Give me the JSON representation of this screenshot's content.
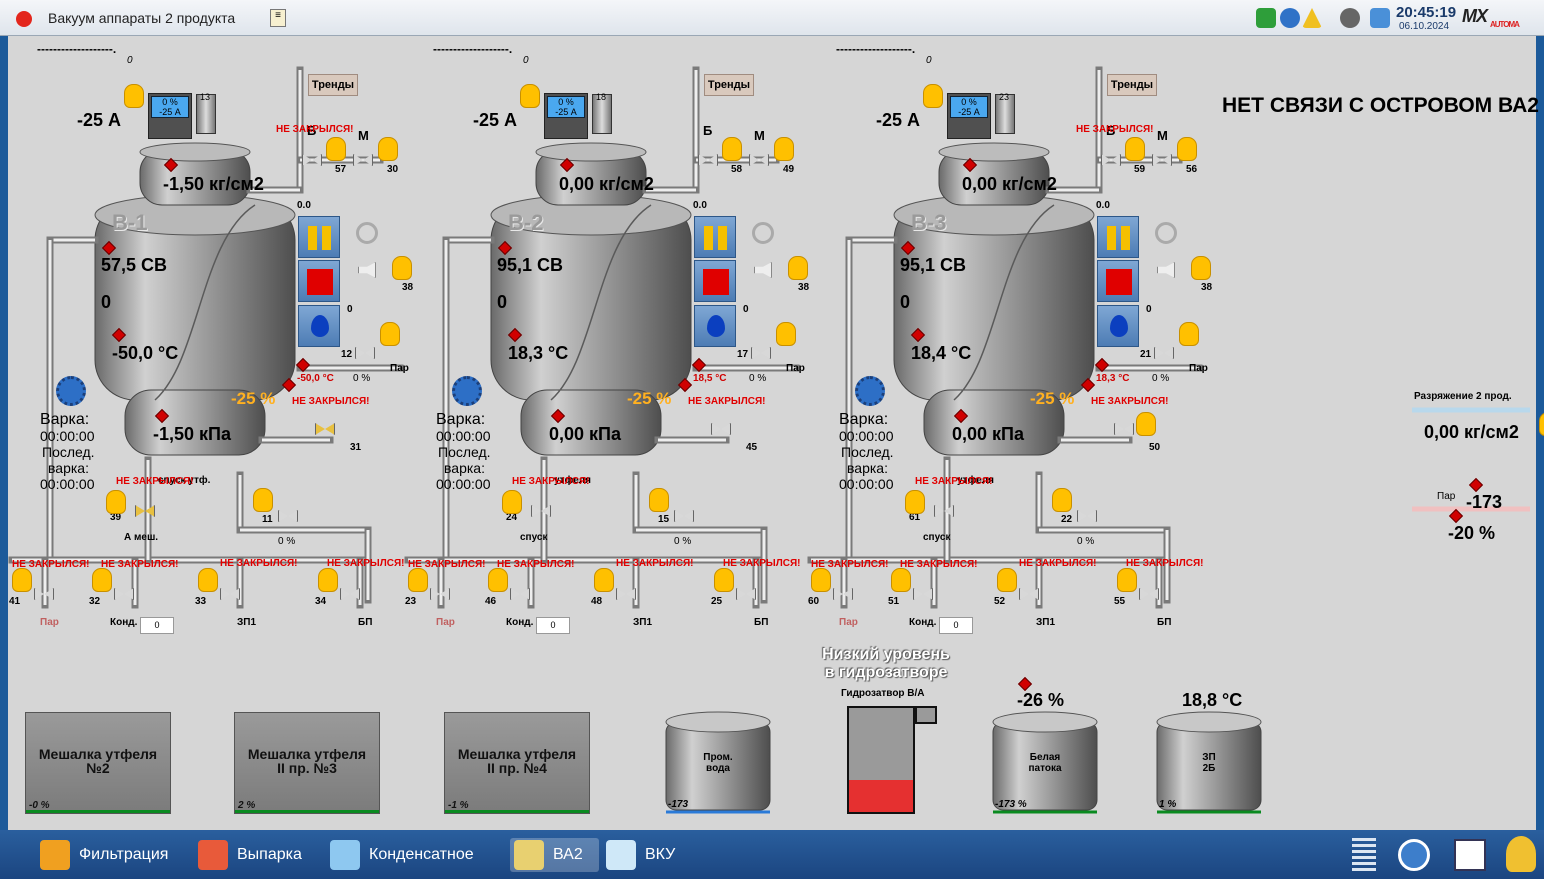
{
  "window": {
    "title": "Вакуум аппараты 2 продукта",
    "time": "20:45:19",
    "date": "06.10.2024",
    "logo": "AUTOMA"
  },
  "banner": "НЕТ СВЯЗИ С ОСТРОВОМ ВА2",
  "trend_label": "Тренды",
  "warn_text": "НЕ ЗАКРЫЛСЯ!",
  "apparatus": [
    {
      "name": "В-1",
      "dashes": "-------------------.",
      "counter": "0",
      "current": "-25 А",
      "meter_pct": "0 %",
      "meter_a": "-25 А",
      "meter_num": "13",
      "pressure_top": "-1,50 кг/см2",
      "sv": "57,5 СВ",
      "zero": "0",
      "temp": "-50,0 °C",
      "level_pct": "-25 %",
      "bottom": "-1,50 кПа",
      "steam_temp": "-50,0 °C",
      "steam_pct": "0 %",
      "steam_valve": "12",
      "steam_label": "Пар",
      "pv": "0.0",
      "varka": "Варка:",
      "varka_time": "00:00:00",
      "posled": "Послед.",
      "varka2": "варка:",
      "posled_time": "00:00:00",
      "valve_b": "Б",
      "valve_m": "М",
      "v_top1": "57",
      "v_top2": "30",
      "v_side": "38",
      "v_side2": "0",
      "v_mid": "31",
      "v_drain": "39",
      "drain_label": "А меш.",
      "drain_label2": "спуск утф.",
      "v_cond": "11",
      "cond_pct": "0 %",
      "bottom_valves": [
        "41",
        "32",
        "33",
        "34"
      ],
      "bottom_labels": [
        "Пар",
        "Конд.",
        "ЗП1",
        "БП"
      ],
      "cond_input": "0",
      "steam_small": "Пар"
    },
    {
      "name": "В-2",
      "dashes": "-------------------.",
      "counter": "0",
      "current": "-25 А",
      "meter_pct": "0 %",
      "meter_a": "-25 А",
      "meter_num": "18",
      "pressure_top": "0,00 кг/см2",
      "sv": "95,1 СВ",
      "zero": "0",
      "temp": "18,3 °C",
      "level_pct": "-25 %",
      "bottom": "0,00 кПа",
      "steam_temp": "18,5 °C",
      "steam_pct": "0 %",
      "steam_valve": "17",
      "steam_label": "Пар",
      "pv": "0.0",
      "varka": "Варка:",
      "varka_time": "00:00:00",
      "posled": "Послед.",
      "varka2": "варка:",
      "posled_time": "00:00:00",
      "valve_b": "Б",
      "valve_m": "М",
      "v_top1": "58",
      "v_top2": "49",
      "v_side": "38",
      "v_side2": "0",
      "v_mid": "45",
      "v_drain": "24",
      "drain_label": "спуск",
      "drain_label2": "утфеля",
      "v_cond": "15",
      "cond_pct": "0 %",
      "bottom_valves": [
        "23",
        "46",
        "48",
        "25"
      ],
      "bottom_labels": [
        "Пар",
        "Конд.",
        "ЗП1",
        "БП"
      ],
      "cond_input": "0",
      "steam_small": ""
    },
    {
      "name": "В-3",
      "dashes": "-------------------.",
      "counter": "0",
      "current": "-25 А",
      "meter_pct": "0 %",
      "meter_a": "-25 А",
      "meter_num": "23",
      "pressure_top": "0,00 кг/см2",
      "sv": "95,1 СВ",
      "zero": "0",
      "temp": "18,4 °C",
      "level_pct": "-25 %",
      "bottom": "0,00 кПа",
      "steam_temp": "18,3 °C",
      "steam_pct": "0 %",
      "steam_valve": "21",
      "steam_label": "Пар",
      "pv": "0.0",
      "varka": "Варка:",
      "varka_time": "00:00:00",
      "posled": "Послед.",
      "varka2": "варка:",
      "posled_time": "00:00:00",
      "valve_b": "Б",
      "valve_m": "М",
      "v_top1": "59",
      "v_top2": "56",
      "v_side": "38",
      "v_side2": "0",
      "v_mid": "50",
      "v_drain": "61",
      "drain_label": "спуск",
      "drain_label2": "утфеля",
      "v_cond": "22",
      "cond_pct": "0 %",
      "bottom_valves": [
        "60",
        "51",
        "52",
        "55"
      ],
      "bottom_labels": [
        "Пар",
        "Конд.",
        "ЗП1",
        "БП"
      ],
      "cond_input": "0",
      "steam_small": ""
    }
  ],
  "vacuum": {
    "label": "Разряжение 2 прод.",
    "value": "0,00 кг/см2"
  },
  "steam_right": {
    "label": "Пар",
    "value": "-173",
    "pct": "-20 %"
  },
  "mixers": [
    {
      "name": "Мешалка утфеля",
      "name2": "№2",
      "pct": "-0 %"
    },
    {
      "name": "Мешалка утфеля",
      "name2": "II пр. №3",
      "pct": "2 %"
    },
    {
      "name": "Мешалка утфеля",
      "name2": "II пр. №4",
      "pct": "-1 %"
    }
  ],
  "tanks": [
    {
      "name": "Пром.",
      "name2": "вода",
      "bottom": "-173",
      "top": ""
    },
    {
      "name": "Белая",
      "name2": "патока",
      "bottom": "-173 %",
      "top": "-26 %"
    },
    {
      "name": "ЗП",
      "name2": "2Б",
      "bottom": "1 %",
      "top": "18,8 °C"
    }
  ],
  "hydro": {
    "alarm1": "Низкий уровень",
    "alarm2": "в гидрозатворе",
    "label": "Гидрозатвор В/А",
    "level": 0.3
  },
  "taskbar": [
    "Фильтрация",
    "Выпарка",
    "Конденсатное",
    "ВА2",
    "ВКУ"
  ],
  "colors": {
    "alarm": "#e00000",
    "accent": "#ffb020",
    "tank_fill": "#e53030"
  }
}
